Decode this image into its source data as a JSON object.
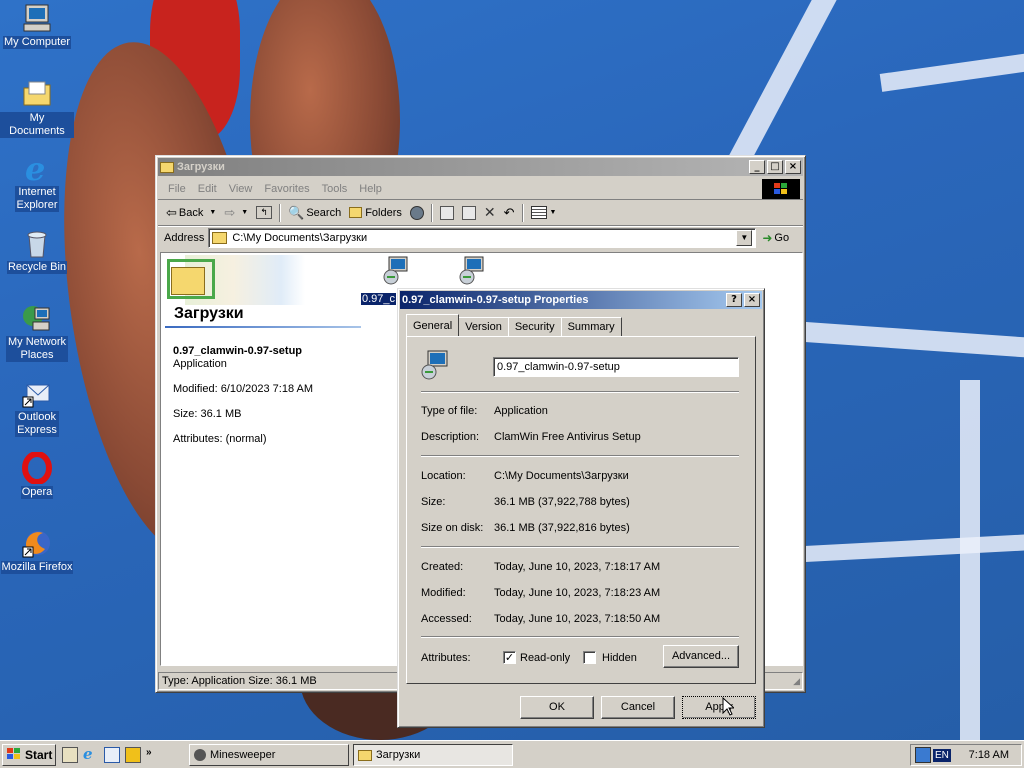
{
  "desktop": {
    "icons": [
      {
        "label": "My Computer"
      },
      {
        "label": "My Documents"
      },
      {
        "label": "Internet Explorer"
      },
      {
        "label": "Recycle Bin"
      },
      {
        "label": "My Network Places"
      },
      {
        "label": "Outlook Express"
      },
      {
        "label": "Opera"
      },
      {
        "label": "Mozilla Firefox"
      }
    ]
  },
  "explorer": {
    "title": "Загрузки",
    "menu": [
      "File",
      "Edit",
      "View",
      "Favorites",
      "Tools",
      "Help"
    ],
    "toolbar": {
      "back": "Back",
      "search": "Search",
      "folders": "Folders"
    },
    "address_label": "Address",
    "address_value": "C:\\My Documents\\Загрузки",
    "go": "Go",
    "folder_heading": "Загрузки",
    "selected": {
      "name": "0.97_clamwin-0.97-setup",
      "type": "Application",
      "modified": "Modified: 6/10/2023 7:18 AM",
      "size": "Size: 36.1 MB",
      "attributes": "Attributes: (normal)"
    },
    "file_label_partial": "0.97_c",
    "status": "Type: Application Size: 36.1 MB"
  },
  "dialog": {
    "title": "0.97_clamwin-0.97-setup Properties",
    "tabs": [
      "General",
      "Version",
      "Security",
      "Summary"
    ],
    "filename": "0.97_clamwin-0.97-setup",
    "rows": {
      "type": {
        "k": "Type of file:",
        "v": "Application"
      },
      "desc": {
        "k": "Description:",
        "v": "ClamWin Free Antivirus Setup"
      },
      "location": {
        "k": "Location:",
        "v": "C:\\My Documents\\Загрузки"
      },
      "size": {
        "k": "Size:",
        "v": "36.1 MB (37,922,788 bytes)"
      },
      "size_disk": {
        "k": "Size on disk:",
        "v": "36.1 MB (37,922,816 bytes)"
      },
      "created": {
        "k": "Created:",
        "v": "Today, June 10, 2023, 7:18:17 AM"
      },
      "modified": {
        "k": "Modified:",
        "v": "Today, June 10, 2023, 7:18:23 AM"
      },
      "accessed": {
        "k": "Accessed:",
        "v": "Today, June 10, 2023, 7:18:50 AM"
      }
    },
    "attributes_label": "Attributes:",
    "readonly": {
      "label": "Read-only",
      "checked": true
    },
    "hidden": {
      "label": "Hidden",
      "checked": false
    },
    "advanced": "Advanced...",
    "ok": "OK",
    "cancel": "Cancel",
    "apply": "Apply"
  },
  "taskbar": {
    "start": "Start",
    "tasks": [
      {
        "label": "Minesweeper",
        "pressed": false
      },
      {
        "label": "Загрузки",
        "pressed": true
      }
    ],
    "lang": "EN",
    "clock": "7:18 AM"
  }
}
